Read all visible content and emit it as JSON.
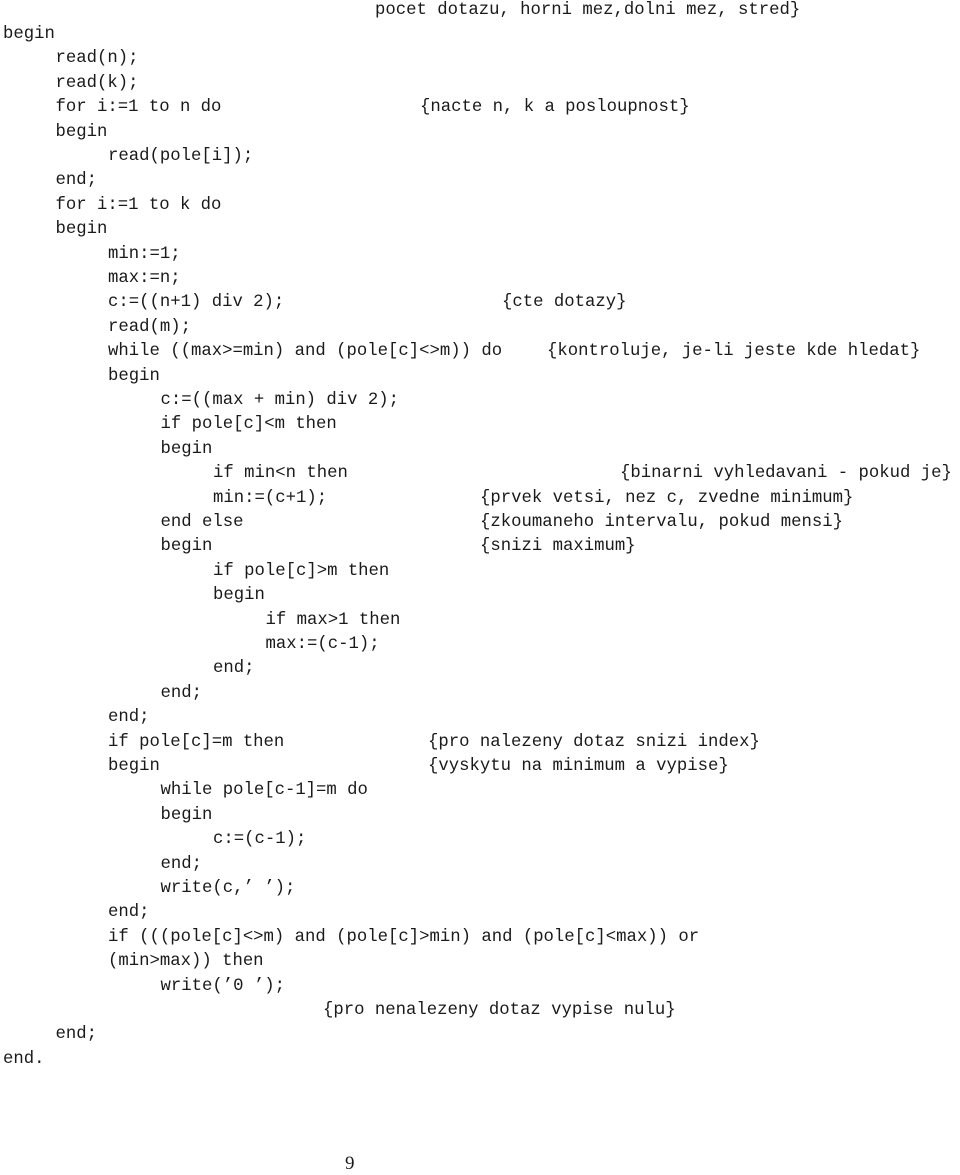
{
  "document": {
    "header_comment": "pocet dotazu, horni mez,dolni mez, stred}",
    "code_lines": [
      {
        "indent": 0,
        "text": "begin"
      },
      {
        "indent": 1,
        "text": "read(n);"
      },
      {
        "indent": 1,
        "text": "read(k);"
      },
      {
        "indent": 1,
        "text": "for i:=1 to n do"
      },
      {
        "indent": 1,
        "text": "begin"
      },
      {
        "indent": 2,
        "text": "read(pole[i]);"
      },
      {
        "indent": 1,
        "text": "end;"
      },
      {
        "indent": 1,
        "text": "for i:=1 to k do"
      },
      {
        "indent": 1,
        "text": "begin"
      },
      {
        "indent": 2,
        "text": "min:=1;"
      },
      {
        "indent": 2,
        "text": "max:=n;"
      },
      {
        "indent": 2,
        "text": "c:=((n+1) div 2);"
      },
      {
        "indent": 2,
        "text": "read(m);"
      },
      {
        "indent": 2,
        "text": "while ((max>=min) and (pole[c]<>m)) do"
      },
      {
        "indent": 2,
        "text": "begin"
      },
      {
        "indent": 3,
        "text": "c:=((max + min) div 2);"
      },
      {
        "indent": 3,
        "text": "if pole[c]<m then"
      },
      {
        "indent": 3,
        "text": "begin"
      },
      {
        "indent": 4,
        "text": "if min<n then"
      },
      {
        "indent": 4,
        "text": "min:=(c+1);"
      },
      {
        "indent": 3,
        "text": "end else"
      },
      {
        "indent": 3,
        "text": "begin"
      },
      {
        "indent": 4,
        "text": "if pole[c]>m then"
      },
      {
        "indent": 4,
        "text": "begin"
      },
      {
        "indent": 5,
        "text": "if max>1 then"
      },
      {
        "indent": 5,
        "text": "max:=(c-1);"
      },
      {
        "indent": 4,
        "text": "end;"
      },
      {
        "indent": 3,
        "text": "end;"
      },
      {
        "indent": 2,
        "text": "end;"
      },
      {
        "indent": 2,
        "text": "if pole[c]=m then"
      },
      {
        "indent": 2,
        "text": "begin"
      },
      {
        "indent": 3,
        "text": "while pole[c-1]=m do"
      },
      {
        "indent": 3,
        "text": "begin"
      },
      {
        "indent": 4,
        "text": "c:=(c-1);"
      },
      {
        "indent": 3,
        "text": "end;"
      },
      {
        "indent": 3,
        "text": "write(c,’ ’);"
      },
      {
        "indent": 2,
        "text": "end;"
      },
      {
        "indent": 2,
        "text": "if (((pole[c]<>m) and (pole[c]>min) and (pole[c]<max)) or"
      },
      {
        "indent": 2,
        "text": "(min>max)) then"
      },
      {
        "indent": 3,
        "text": "write(’0 ’);"
      },
      {
        "indent": 0,
        "text": ""
      },
      {
        "indent": 1,
        "text": "end;"
      },
      {
        "indent": 0,
        "text": "end."
      }
    ],
    "comments": [
      {
        "line": 3,
        "text": "{nacte n, k a posloupnost}"
      },
      {
        "line": 11,
        "text": "{cte dotazy}"
      },
      {
        "line": 13,
        "text": "{kontroluje, je-li jeste kde hledat}"
      },
      {
        "line": 18,
        "text": "{binarni vyhledavani - pokud je}"
      },
      {
        "line": 19,
        "text": "{prvek vetsi, nez c, zvedne minimum}"
      },
      {
        "line": 20,
        "text": "{zkoumaneho intervalu, pokud mensi}"
      },
      {
        "line": 21,
        "text": "{snizi maximum}"
      },
      {
        "line": 29,
        "text": "{pro nalezeny dotaz snizi index}"
      },
      {
        "line": 30,
        "text": "{vyskytu na minimum a vypise}"
      },
      {
        "line": 40,
        "text": "{pro nenalezeny dotaz vypise nulu}"
      }
    ],
    "page_number": "9"
  }
}
